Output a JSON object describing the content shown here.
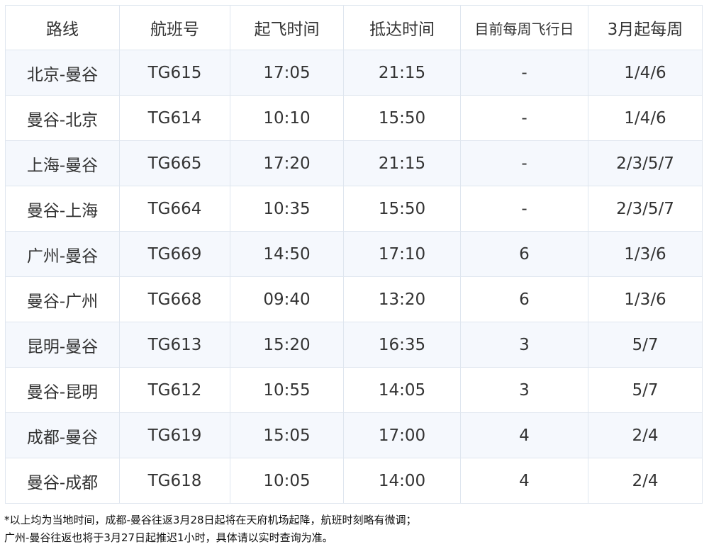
{
  "table": {
    "headers": [
      "路线",
      "航班号",
      "起飞时间",
      "抵达时间",
      "目前每周飞行日",
      "3月起每周"
    ],
    "rows": [
      [
        "北京-曼谷",
        "TG615",
        "17:05",
        "21:15",
        "-",
        "1/4/6"
      ],
      [
        "曼谷-北京",
        "TG614",
        "10:10",
        "15:50",
        "-",
        "1/4/6"
      ],
      [
        "上海-曼谷",
        "TG665",
        "17:20",
        "21:15",
        "-",
        "2/3/5/7"
      ],
      [
        "曼谷-上海",
        "TG664",
        "10:35",
        "15:50",
        "-",
        "2/3/5/7"
      ],
      [
        "广州-曼谷",
        "TG669",
        "14:50",
        "17:10",
        "6",
        "1/3/6"
      ],
      [
        "曼谷-广州",
        "TG668",
        "09:40",
        "13:20",
        "6",
        "1/3/6"
      ],
      [
        "昆明-曼谷",
        "TG613",
        "15:20",
        "16:35",
        "3",
        "5/7"
      ],
      [
        "曼谷-昆明",
        "TG612",
        "10:55",
        "14:05",
        "3",
        "5/7"
      ],
      [
        "成都-曼谷",
        "TG619",
        "15:05",
        "17:00",
        "4",
        "2/4"
      ],
      [
        "曼谷-成都",
        "TG618",
        "10:05",
        "14:00",
        "4",
        "2/4"
      ]
    ]
  },
  "notes": [
    "*以上均为当地时间，成都-曼谷往返3月28日起将在天府机场起降，航班时刻略有微调；",
    "广州-曼谷往返也将于3月27日起推迟1小时，具体请以实时查询为准。"
  ],
  "colors": {
    "border": "#dfe6ef",
    "row_shade": "#f5f8fd",
    "text": "#333333"
  }
}
